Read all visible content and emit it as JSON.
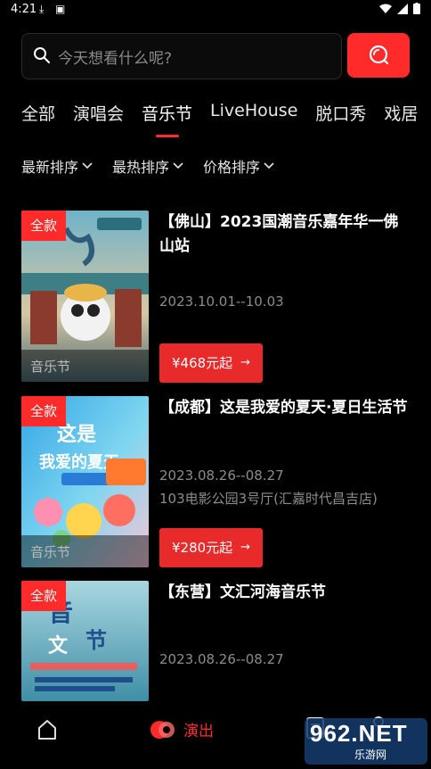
{
  "status": {
    "time": "4:21"
  },
  "search": {
    "placeholder": "今天想看什么呢?"
  },
  "tabs": [
    {
      "label": "全部"
    },
    {
      "label": "演唱会"
    },
    {
      "label": "音乐节",
      "active": true
    },
    {
      "label": "LiveHouse"
    },
    {
      "label": "脱口秀"
    },
    {
      "label": "戏居"
    }
  ],
  "sorts": [
    {
      "label": "最新排序"
    },
    {
      "label": "最热排序"
    },
    {
      "label": "价格排序"
    }
  ],
  "events": [
    {
      "badge": "全款",
      "category": "音乐节",
      "title": "【佛山】2023国潮音乐嘉年华一佛山站",
      "date": "2023.10.01--10.03",
      "venue": "",
      "price": "¥468元起",
      "arrow": "→"
    },
    {
      "badge": "全款",
      "category": "音乐节",
      "title": "【成都】这是我爱的夏天·夏日生活节",
      "date": "2023.08.26--08.27",
      "venue": "103电影公园3号厅(汇嘉时代昌吉店)",
      "price": "¥280元起",
      "arrow": "→"
    },
    {
      "badge": "全款",
      "category": "",
      "title": "【东营】文汇河海音乐节",
      "date": "2023.08.26--08.27",
      "venue": "",
      "price": "",
      "arrow": ""
    }
  ],
  "bottom_nav": {
    "show_label": "演出"
  },
  "watermark": {
    "big": "962.NET",
    "small": "乐游网"
  },
  "colors": {
    "accent": "#ff2b2b",
    "background": "#000000",
    "muted": "#8c8c8c"
  }
}
